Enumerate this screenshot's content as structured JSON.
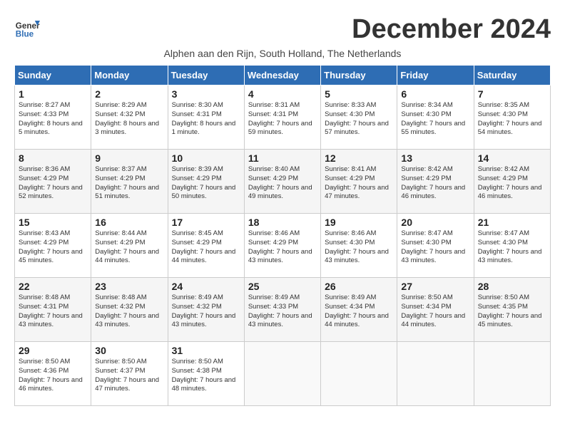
{
  "header": {
    "logo_line1": "General",
    "logo_line2": "Blue",
    "title": "December 2024",
    "subtitle": "Alphen aan den Rijn, South Holland, The Netherlands"
  },
  "days_of_week": [
    "Sunday",
    "Monday",
    "Tuesday",
    "Wednesday",
    "Thursday",
    "Friday",
    "Saturday"
  ],
  "weeks": [
    [
      {
        "day": "1",
        "sunrise": "8:27 AM",
        "sunset": "4:33 PM",
        "daylight": "8 hours and 5 minutes."
      },
      {
        "day": "2",
        "sunrise": "8:29 AM",
        "sunset": "4:32 PM",
        "daylight": "8 hours and 3 minutes."
      },
      {
        "day": "3",
        "sunrise": "8:30 AM",
        "sunset": "4:31 PM",
        "daylight": "8 hours and 1 minute."
      },
      {
        "day": "4",
        "sunrise": "8:31 AM",
        "sunset": "4:31 PM",
        "daylight": "7 hours and 59 minutes."
      },
      {
        "day": "5",
        "sunrise": "8:33 AM",
        "sunset": "4:30 PM",
        "daylight": "7 hours and 57 minutes."
      },
      {
        "day": "6",
        "sunrise": "8:34 AM",
        "sunset": "4:30 PM",
        "daylight": "7 hours and 55 minutes."
      },
      {
        "day": "7",
        "sunrise": "8:35 AM",
        "sunset": "4:30 PM",
        "daylight": "7 hours and 54 minutes."
      }
    ],
    [
      {
        "day": "8",
        "sunrise": "8:36 AM",
        "sunset": "4:29 PM",
        "daylight": "7 hours and 52 minutes."
      },
      {
        "day": "9",
        "sunrise": "8:37 AM",
        "sunset": "4:29 PM",
        "daylight": "7 hours and 51 minutes."
      },
      {
        "day": "10",
        "sunrise": "8:39 AM",
        "sunset": "4:29 PM",
        "daylight": "7 hours and 50 minutes."
      },
      {
        "day": "11",
        "sunrise": "8:40 AM",
        "sunset": "4:29 PM",
        "daylight": "7 hours and 49 minutes."
      },
      {
        "day": "12",
        "sunrise": "8:41 AM",
        "sunset": "4:29 PM",
        "daylight": "7 hours and 47 minutes."
      },
      {
        "day": "13",
        "sunrise": "8:42 AM",
        "sunset": "4:29 PM",
        "daylight": "7 hours and 46 minutes."
      },
      {
        "day": "14",
        "sunrise": "8:42 AM",
        "sunset": "4:29 PM",
        "daylight": "7 hours and 46 minutes."
      }
    ],
    [
      {
        "day": "15",
        "sunrise": "8:43 AM",
        "sunset": "4:29 PM",
        "daylight": "7 hours and 45 minutes."
      },
      {
        "day": "16",
        "sunrise": "8:44 AM",
        "sunset": "4:29 PM",
        "daylight": "7 hours and 44 minutes."
      },
      {
        "day": "17",
        "sunrise": "8:45 AM",
        "sunset": "4:29 PM",
        "daylight": "7 hours and 44 minutes."
      },
      {
        "day": "18",
        "sunrise": "8:46 AM",
        "sunset": "4:29 PM",
        "daylight": "7 hours and 43 minutes."
      },
      {
        "day": "19",
        "sunrise": "8:46 AM",
        "sunset": "4:30 PM",
        "daylight": "7 hours and 43 minutes."
      },
      {
        "day": "20",
        "sunrise": "8:47 AM",
        "sunset": "4:30 PM",
        "daylight": "7 hours and 43 minutes."
      },
      {
        "day": "21",
        "sunrise": "8:47 AM",
        "sunset": "4:30 PM",
        "daylight": "7 hours and 43 minutes."
      }
    ],
    [
      {
        "day": "22",
        "sunrise": "8:48 AM",
        "sunset": "4:31 PM",
        "daylight": "7 hours and 43 minutes."
      },
      {
        "day": "23",
        "sunrise": "8:48 AM",
        "sunset": "4:32 PM",
        "daylight": "7 hours and 43 minutes."
      },
      {
        "day": "24",
        "sunrise": "8:49 AM",
        "sunset": "4:32 PM",
        "daylight": "7 hours and 43 minutes."
      },
      {
        "day": "25",
        "sunrise": "8:49 AM",
        "sunset": "4:33 PM",
        "daylight": "7 hours and 43 minutes."
      },
      {
        "day": "26",
        "sunrise": "8:49 AM",
        "sunset": "4:34 PM",
        "daylight": "7 hours and 44 minutes."
      },
      {
        "day": "27",
        "sunrise": "8:50 AM",
        "sunset": "4:34 PM",
        "daylight": "7 hours and 44 minutes."
      },
      {
        "day": "28",
        "sunrise": "8:50 AM",
        "sunset": "4:35 PM",
        "daylight": "7 hours and 45 minutes."
      }
    ],
    [
      {
        "day": "29",
        "sunrise": "8:50 AM",
        "sunset": "4:36 PM",
        "daylight": "7 hours and 46 minutes."
      },
      {
        "day": "30",
        "sunrise": "8:50 AM",
        "sunset": "4:37 PM",
        "daylight": "7 hours and 47 minutes."
      },
      {
        "day": "31",
        "sunrise": "8:50 AM",
        "sunset": "4:38 PM",
        "daylight": "7 hours and 48 minutes."
      },
      null,
      null,
      null,
      null
    ]
  ],
  "labels": {
    "sunrise": "Sunrise:",
    "sunset": "Sunset:",
    "daylight": "Daylight:"
  }
}
